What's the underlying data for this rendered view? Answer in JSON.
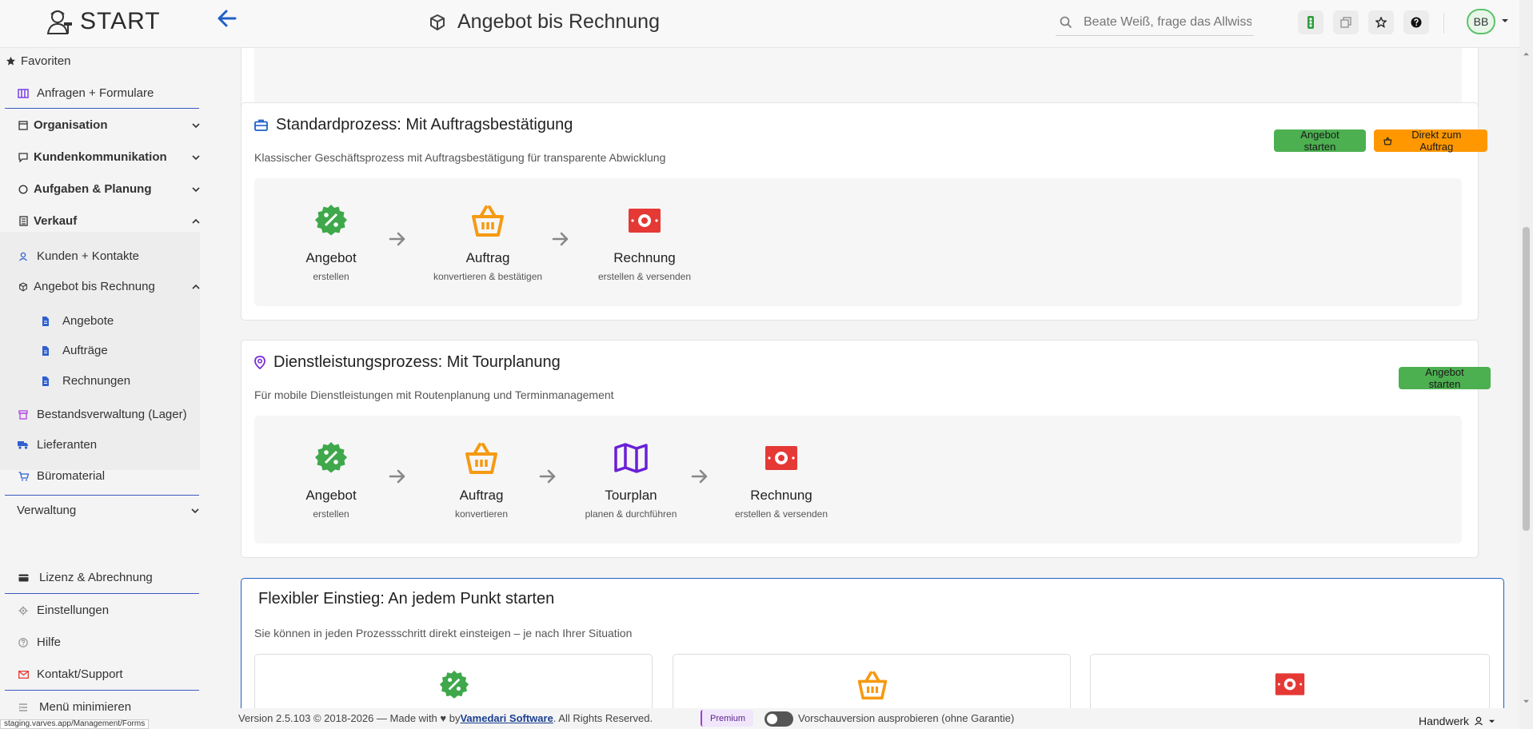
{
  "app": {
    "logo_text": "START",
    "page_title": "Angebot bis Rechnung"
  },
  "search": {
    "placeholder": "Beate Weiß, frage das Allwissende"
  },
  "user": {
    "initials": "BB"
  },
  "sidebar": {
    "favorites": "Favoriten",
    "items": [
      {
        "label": "Anfragen + Formulare"
      },
      {
        "label": "Organisation"
      },
      {
        "label": "Kundenkommunikation"
      },
      {
        "label": "Aufgaben & Planung"
      },
      {
        "label": "Verkauf"
      },
      {
        "label": "Kunden + Kontakte"
      },
      {
        "label": "Angebot bis Rechnung"
      },
      {
        "label": "Angebote"
      },
      {
        "label": "Aufträge"
      },
      {
        "label": "Rechnungen"
      },
      {
        "label": "Bestandsverwaltung (Lager)"
      },
      {
        "label": "Lieferanten"
      },
      {
        "label": "Büromaterial"
      },
      {
        "label": "Verwaltung"
      },
      {
        "label": "Lizenz & Abrechnung"
      },
      {
        "label": "Einstellungen"
      },
      {
        "label": "Hilfe"
      },
      {
        "label": "Kontakt/Support"
      },
      {
        "label": "Menü minimieren"
      }
    ]
  },
  "cards": {
    "standard": {
      "title": "Standardprozess: Mit Auftragsbestätigung",
      "desc": "Klassischer Geschäftsprozess mit Auftragsbestätigung für transparente Abwicklung",
      "btn_start": "Angebot starten",
      "btn_direct": "Direkt zum Auftrag",
      "steps": [
        {
          "name": "Angebot",
          "sub": "erstellen"
        },
        {
          "name": "Auftrag",
          "sub": "konvertieren & bestätigen"
        },
        {
          "name": "Rechnung",
          "sub": "erstellen & versenden"
        }
      ]
    },
    "service": {
      "title": "Dienstleistungsprozess: Mit Tourplanung",
      "desc": "Für mobile Dienstleistungen mit Routenplanung und Terminmanagement",
      "btn_start": "Angebot starten",
      "steps": [
        {
          "name": "Angebot",
          "sub": "erstellen"
        },
        {
          "name": "Auftrag",
          "sub": "konvertieren"
        },
        {
          "name": "Tourplan",
          "sub": "planen & durchführen"
        },
        {
          "name": "Rechnung",
          "sub": "erstellen & versenden"
        }
      ]
    },
    "flexible": {
      "title": "Flexibler Einstieg: An jedem Punkt starten",
      "desc": "Sie können in jeden Prozessschritt direkt einsteigen – je nach Ihrer Situation"
    }
  },
  "footer": {
    "version": "Version 2.5.103 © 2018-2026 — Made with ♥ by ",
    "company": "Vamedari Software",
    "rights": ". All Rights Reserved.",
    "badge": "Premium",
    "preview": "Vorschauversion ausprobieren (ohne Garantie)",
    "workspace": "Handwerk",
    "status_url": "staging.varves.app/Management/Forms"
  },
  "colors": {
    "green": "#4caf50",
    "orange": "#ff9800",
    "red": "#e53935",
    "purple": "#6a1fd6",
    "blue": "#1f5fc7"
  }
}
